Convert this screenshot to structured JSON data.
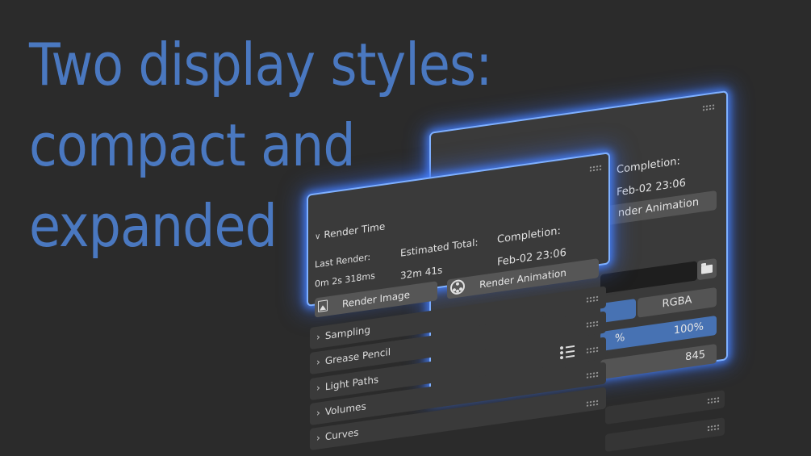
{
  "headline": {
    "line1": "Two display styles:",
    "line2": "compact and",
    "line3": "expanded"
  },
  "colors": {
    "background": "#2b2b2b",
    "headline": "#4a78c0",
    "panel": "#3a3a3a",
    "glow": "#7fb0ff",
    "accent_button": "#4772b3"
  },
  "expanded_panel": {
    "title": "Render Time",
    "completion_label": "Completion:",
    "completion_value": "Feb-02 23:06",
    "render_animation_label": "nder Animation",
    "format_value": "RGBA",
    "percent_symbol": "%",
    "percent_value": "100%",
    "number_value": "845"
  },
  "compact_panel": {
    "title": "Render Time",
    "last_render_label": "Last Render:",
    "last_render_value": "0m 2s 318ms",
    "estimated_total_label": "Estimated Total:",
    "estimated_total_value": "32m 41s",
    "completion_label": "Completion:",
    "completion_value": "Feb-02 23:06",
    "render_image_button": "Render Image",
    "render_animation_button": "Render Animation"
  },
  "subpanels": [
    {
      "label": "Sampling"
    },
    {
      "label": "Grease Pencil"
    },
    {
      "label": "Light Paths"
    },
    {
      "label": "Volumes"
    },
    {
      "label": "Curves"
    }
  ],
  "icons": {
    "collapse": "chevron-down-icon",
    "expand": "chevron-right-icon",
    "drag": "grip-icon",
    "render_image": "render-image-icon",
    "render_animation": "film-reel-icon",
    "folder": "folder-icon",
    "presets": "list-icon"
  }
}
